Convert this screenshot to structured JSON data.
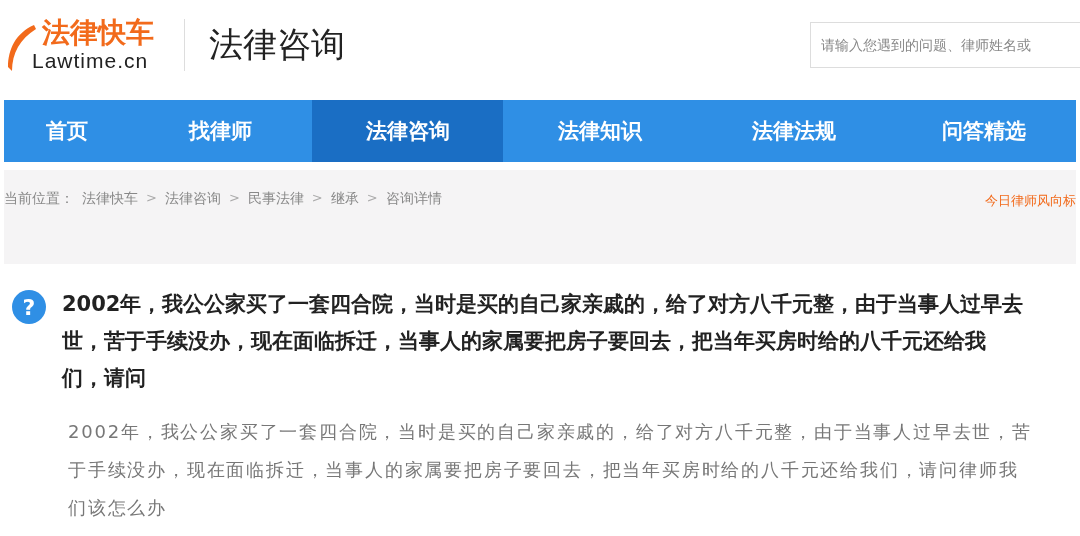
{
  "header": {
    "logo_name": "法律快车",
    "logo_domain": "Lawtime.cn",
    "section_title": "法律咨询",
    "search": {
      "placeholder": "请输入您遇到的问题、律师姓名或"
    }
  },
  "nav": [
    {
      "label": "首页",
      "selected": false
    },
    {
      "label": "找律师",
      "selected": false
    },
    {
      "label": "法律咨询",
      "selected": true
    },
    {
      "label": "法律知识",
      "selected": false
    },
    {
      "label": "法律法规",
      "selected": false
    },
    {
      "label": "问答精选",
      "selected": false
    }
  ],
  "breadcrumb": {
    "prefix": "当前位置：",
    "items": [
      {
        "kind": "link",
        "text": "法律快车"
      },
      {
        "kind": "sep",
        "text": ">"
      },
      {
        "kind": "link",
        "text": "法律咨询"
      },
      {
        "kind": "sep",
        "text": ">"
      },
      {
        "kind": "link",
        "text": "民事法律"
      },
      {
        "kind": "sep",
        "text": ">"
      },
      {
        "kind": "link",
        "text": "继承"
      },
      {
        "kind": "sep",
        "text": ">"
      },
      {
        "kind": "link",
        "text": "咨询详情"
      }
    ],
    "side_link": "今日律师风向标"
  },
  "question": {
    "icon": "?",
    "title": "2002年，我公公家买了一套四合院，当时是买的自己家亲戚的，给了对方八千元整，由于当事人过早去世，苦于手续没办，现在面临拆迁，当事人的家属要把房子要回去，把当年买房时给的八千元还给我们，请问",
    "detail": "2002年，我公公家买了一套四合院，当时是买的自己家亲戚的，给了对方八千元整，由于当事人过早去世，苦于手续没办，现在面临拆迁，当事人的家属要把房子要回去，把当年买房时给的八千元还给我们，请问律师我们该怎么办"
  }
}
